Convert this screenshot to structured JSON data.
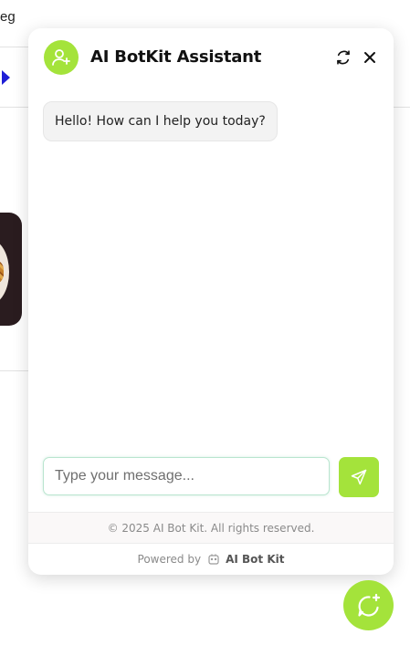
{
  "background": {
    "partial_text": "eg"
  },
  "widget": {
    "title": "AI BotKit Assistant",
    "avatar_icon": "user-sparkle-icon",
    "accent_color": "#a4e33b",
    "header_actions": [
      {
        "icon": "refresh-icon"
      },
      {
        "icon": "close-icon"
      }
    ],
    "messages": [
      {
        "sender": "bot",
        "text": "Hello! How can I help you today?"
      }
    ],
    "input": {
      "placeholder": "Type your message...",
      "value": ""
    },
    "send_icon": "send-icon",
    "footer": {
      "copyright": "© 2025 AI Bot Kit. All rights reserved.",
      "powered_by_label": "Powered by",
      "powered_by_brand": "AI Bot Kit"
    }
  },
  "launcher": {
    "icon": "chat-sparkle-icon"
  }
}
